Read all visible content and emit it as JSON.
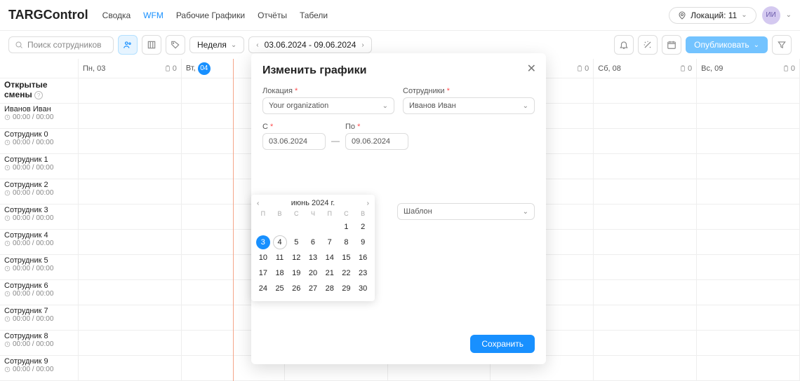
{
  "brand": "TARGControl",
  "nav": [
    "Сводка",
    "WFM",
    "Рабочие Графики",
    "Отчёты",
    "Табели"
  ],
  "nav_active_index": 1,
  "location_btn": "Локаций: 11",
  "avatar": "ИИ",
  "search_placeholder": "Поиск сотрудников",
  "period_label": "Неделя",
  "date_range": "03.06.2024 - 09.06.2024",
  "publish_label": "Опубликовать",
  "open_shifts": "Открытые смены",
  "day_headers": [
    {
      "label": "Пн, 03",
      "num": "03",
      "today": false,
      "count": "0"
    },
    {
      "label": "Вт,",
      "num": "04",
      "today": true,
      "count": ""
    },
    {
      "label": "",
      "num": "",
      "today": false,
      "count": ""
    },
    {
      "label": "",
      "num": "",
      "today": false,
      "count": ""
    },
    {
      "label": "",
      "num": "",
      "today": false,
      "count": "0"
    },
    {
      "label": "Сб, 08",
      "num": "08",
      "today": false,
      "count": "0"
    },
    {
      "label": "Вс, 09",
      "num": "09",
      "today": false,
      "count": "0"
    }
  ],
  "employees": [
    {
      "name": "Иванов Иван",
      "sub": "00:00 / 00:00"
    },
    {
      "name": "Сотрудник 0",
      "sub": "00:00 / 00:00"
    },
    {
      "name": "Сотрудник 1",
      "sub": "00:00 / 00:00"
    },
    {
      "name": "Сотрудник 2",
      "sub": "00:00 / 00:00"
    },
    {
      "name": "Сотрудник 3",
      "sub": "00:00 / 00:00"
    },
    {
      "name": "Сотрудник 4",
      "sub": "00:00 / 00:00"
    },
    {
      "name": "Сотрудник 5",
      "sub": "00:00 / 00:00"
    },
    {
      "name": "Сотрудник 6",
      "sub": "00:00 / 00:00"
    },
    {
      "name": "Сотрудник 7",
      "sub": "00:00 / 00:00"
    },
    {
      "name": "Сотрудник 8",
      "sub": "00:00 / 00:00"
    },
    {
      "name": "Сотрудник 9",
      "sub": "00:00 / 00:00"
    }
  ],
  "modal": {
    "title": "Изменить графики",
    "location_label": "Локация",
    "location_value": "Your organization",
    "employees_label": "Сотрудники",
    "employees_value": "Иванов Иван",
    "from_label": "С",
    "to_label": "По",
    "from_value": "03.06.2024",
    "to_value": "09.06.2024",
    "template_label": "Шаблон",
    "save_label": "Сохранить"
  },
  "calendar": {
    "title": "июнь 2024 г.",
    "dow": [
      "П",
      "В",
      "С",
      "Ч",
      "П",
      "С",
      "В"
    ],
    "weeks": [
      [
        "",
        "",
        "",
        "",
        "",
        "1",
        "2"
      ],
      [
        "3",
        "4",
        "5",
        "6",
        "7",
        "8",
        "9"
      ],
      [
        "10",
        "11",
        "12",
        "13",
        "14",
        "15",
        "16"
      ],
      [
        "17",
        "18",
        "19",
        "20",
        "21",
        "22",
        "23"
      ],
      [
        "24",
        "25",
        "26",
        "27",
        "28",
        "29",
        "30"
      ]
    ],
    "selected": "3",
    "outlined": "4"
  }
}
